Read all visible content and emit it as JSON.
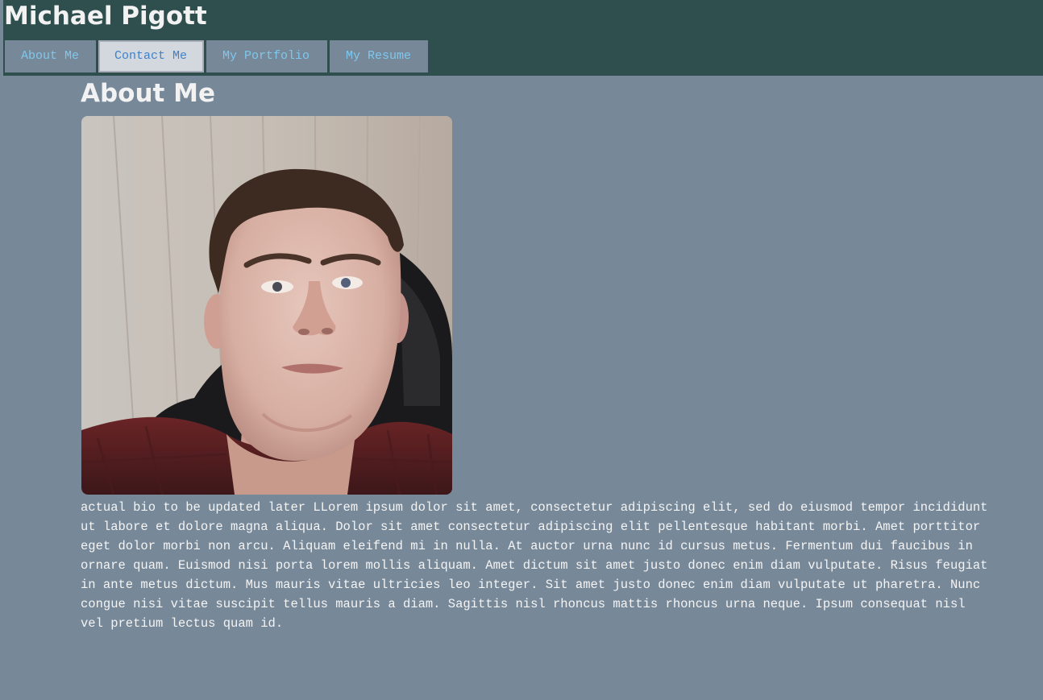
{
  "header": {
    "title": "Michael Pigott",
    "background": "#2f4f4f"
  },
  "nav": {
    "tabs": [
      {
        "label": "About Me",
        "active": false
      },
      {
        "label": "Contact Me",
        "active": true
      },
      {
        "label": "My Portfolio",
        "active": false
      },
      {
        "label": "My Resume",
        "active": false
      }
    ]
  },
  "main": {
    "heading": "About Me",
    "photo": {
      "alt": "profile-photo"
    },
    "bio": "actual bio to be updated later LLorem ipsum dolor sit amet, consectetur adipiscing elit, sed do eiusmod tempor incididunt ut labore et dolore magna aliqua. Dolor sit amet consectetur adipiscing elit pellentesque habitant morbi. Amet porttitor eget dolor morbi non arcu. Aliquam eleifend mi in nulla. At auctor urna nunc id cursus metus. Fermentum dui faucibus in ornare quam. Euismod nisi porta lorem mollis aliquam. Amet dictum sit amet justo donec enim diam vulputate. Risus feugiat in ante metus dictum. Mus mauris vitae ultricies leo integer. Sit amet justo donec enim diam vulputate ut pharetra. Nunc congue nisi vitae suscipit tellus mauris a diam. Sagittis nisl rhoncus mattis rhoncus urna neque. Ipsum consequat nisl vel pretium lectus quam id."
  },
  "colors": {
    "page_background": "#778899",
    "tab_text": "#7ec8ee",
    "active_tab_background": "#d3d7de",
    "active_tab_text": "#3f82c9",
    "heading_text": "#f2f2f2"
  }
}
